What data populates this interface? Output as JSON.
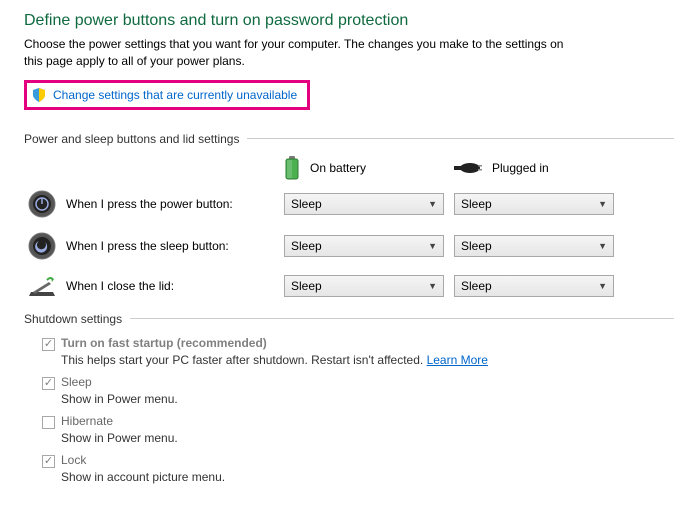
{
  "title": "Define power buttons and turn on password protection",
  "description": "Choose the power settings that you want for your computer. The changes you make to the settings on this page apply to all of your power plans.",
  "changeLink": "Change settings that are currently unavailable",
  "section1": {
    "label": "Power and sleep buttons and lid settings",
    "colBattery": "On battery",
    "colPlugged": "Plugged in",
    "rows": [
      {
        "label": "When I press the power button:",
        "battery": "Sleep",
        "plugged": "Sleep"
      },
      {
        "label": "When I press the sleep button:",
        "battery": "Sleep",
        "plugged": "Sleep"
      },
      {
        "label": "When I close the lid:",
        "battery": "Sleep",
        "plugged": "Sleep"
      }
    ]
  },
  "section2": {
    "label": "Shutdown settings",
    "items": [
      {
        "checked": true,
        "label": "Turn on fast startup (recommended)",
        "sub": "This helps start your PC faster after shutdown. Restart isn't affected.",
        "link": "Learn More"
      },
      {
        "checked": true,
        "label": "Sleep",
        "sub": "Show in Power menu."
      },
      {
        "checked": false,
        "label": "Hibernate",
        "sub": "Show in Power menu."
      },
      {
        "checked": true,
        "label": "Lock",
        "sub": "Show in account picture menu."
      }
    ]
  }
}
